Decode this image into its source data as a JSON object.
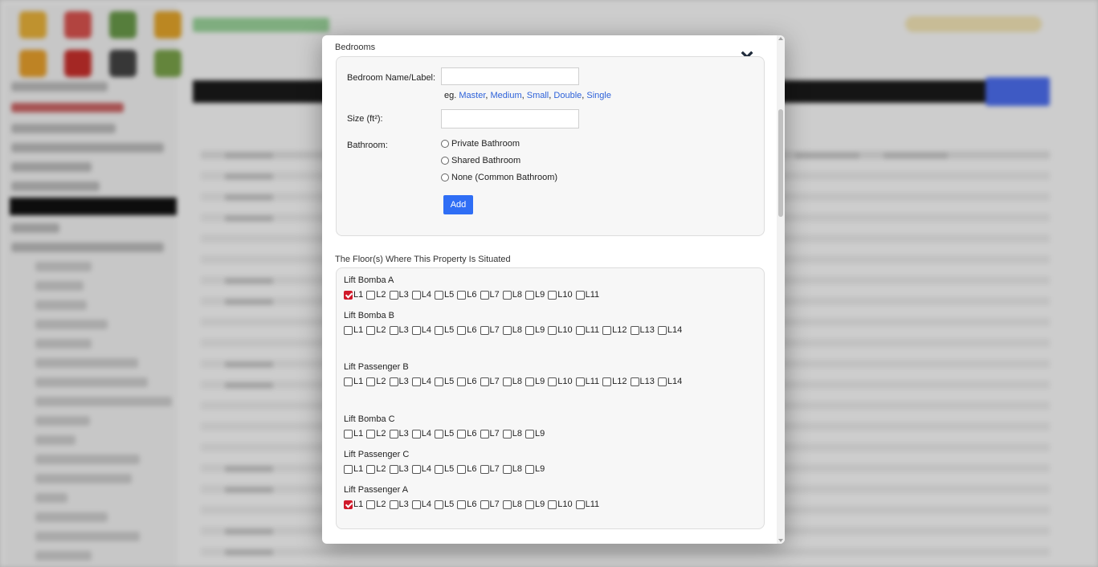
{
  "modal": {
    "close_icon": "×",
    "bedrooms": {
      "title": "Bedrooms",
      "name_label": "Bedroom Name/Label:",
      "name_value": "",
      "hint_prefix": "eg.",
      "examples": [
        "Master",
        "Medium",
        "Small",
        "Double",
        "Single"
      ],
      "size_label": "Size (ft²):",
      "size_value": "",
      "bathroom_label": "Bathroom:",
      "bathroom_options": [
        "Private Bathroom",
        "Shared Bathroom",
        "None (Common Bathroom)"
      ],
      "add_label": "Add"
    },
    "floors": {
      "title": "The Floor(s) Where This Property Is Situated",
      "lifts": [
        {
          "name": "Lift Bomba A",
          "levels": [
            "L1",
            "L2",
            "L3",
            "L4",
            "L5",
            "L6",
            "L7",
            "L8",
            "L9",
            "L10",
            "L11"
          ],
          "checked": [
            "L1"
          ]
        },
        {
          "name": "Lift Bomba B",
          "levels": [
            "L1",
            "L2",
            "L3",
            "L4",
            "L5",
            "L6",
            "L7",
            "L8",
            "L9",
            "L10",
            "L11",
            "L12",
            "L13",
            "L14"
          ],
          "checked": []
        },
        {
          "name": "Lift Passenger B",
          "levels": [
            "L1",
            "L2",
            "L3",
            "L4",
            "L5",
            "L6",
            "L7",
            "L8",
            "L9",
            "L10",
            "L11",
            "L12",
            "L13",
            "L14"
          ],
          "checked": []
        },
        {
          "name": "Lift Bomba C",
          "levels": [
            "L1",
            "L2",
            "L3",
            "L4",
            "L5",
            "L6",
            "L7",
            "L8",
            "L9"
          ],
          "checked": []
        },
        {
          "name": "Lift Passenger C",
          "levels": [
            "L1",
            "L2",
            "L3",
            "L4",
            "L5",
            "L6",
            "L7",
            "L8",
            "L9"
          ],
          "checked": []
        },
        {
          "name": "Lift Passenger A",
          "levels": [
            "L1",
            "L2",
            "L3",
            "L4",
            "L5",
            "L6",
            "L7",
            "L8",
            "L9",
            "L10",
            "L11"
          ],
          "checked": [
            "L1"
          ]
        }
      ]
    }
  },
  "colors": {
    "accent_blue": "#2f6ef5",
    "link_blue": "#2e62d9",
    "checked_red": "#d0192a",
    "close_navy": "#1f2b3b"
  }
}
